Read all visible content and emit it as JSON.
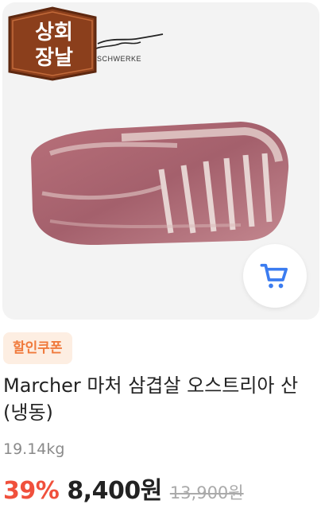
{
  "badge": {
    "line1": "상회",
    "line2": "장날"
  },
  "brand": {
    "subtitle": "SCHWERKE"
  },
  "coupon": {
    "label": "할인쿠폰"
  },
  "product": {
    "title": "Marcher 마처 삼겹살 오스트리아 산 (냉동)",
    "weight": "19.14kg",
    "discount": "39%",
    "price": "8,400원",
    "original_price": "13,900원"
  },
  "colors": {
    "discount": "#f0503c",
    "coupon_bg": "#fdeee2",
    "coupon_text": "#f07a3c",
    "cart_icon": "#3b7cf0",
    "badge_bg": "#8b3f1c"
  },
  "icons": {
    "cart": "cart-icon"
  }
}
